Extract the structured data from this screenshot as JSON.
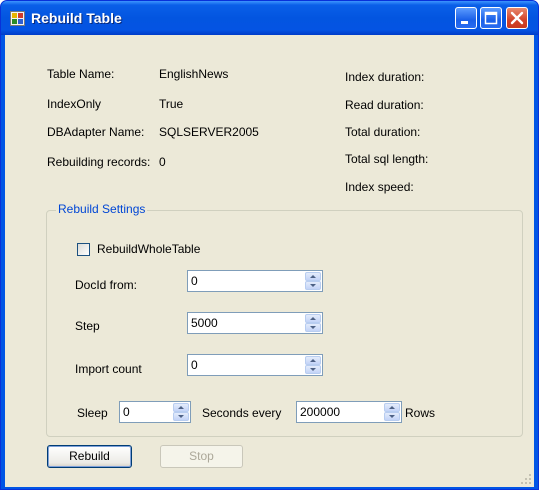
{
  "window": {
    "title": "Rebuild Table",
    "icon": "app-icon",
    "controls": [
      "minimize-icon",
      "maximize-icon",
      "close-icon"
    ]
  },
  "info": {
    "table_name_label": "Table Name:",
    "table_name_value": "EnglishNews",
    "index_only_label": "IndexOnly",
    "index_only_value": "True",
    "dbadapter_label": "DBAdapter Name:",
    "dbadapter_value": "SQLSERVER2005",
    "rebuilding_label": "Rebuilding records:",
    "rebuilding_value": "0"
  },
  "stats": {
    "index_duration": "Index duration:",
    "read_duration": "Read duration:",
    "total_duration": "Total duration:",
    "total_sql_length": "Total sql length:",
    "index_speed": "Index speed:"
  },
  "settings": {
    "group_title": "Rebuild Settings",
    "rebuild_whole_table_label": "RebuildWholeTable",
    "rebuild_whole_table_checked": false,
    "docid_from_label": "DocId from:",
    "docid_from_value": "0",
    "step_label": "Step",
    "step_value": "5000",
    "import_count_label": "Import count",
    "import_count_value": "0",
    "sleep_label": "Sleep",
    "sleep_value": "0",
    "seconds_every_label": "Seconds every",
    "rows_value": "200000",
    "rows_label": "Rows"
  },
  "buttons": {
    "rebuild": "Rebuild",
    "stop": "Stop"
  },
  "colors": {
    "titlebar": "#0355e0",
    "client_bg": "#ece9d8",
    "group_title": "#0046d5",
    "close_button": "#d1432a"
  }
}
